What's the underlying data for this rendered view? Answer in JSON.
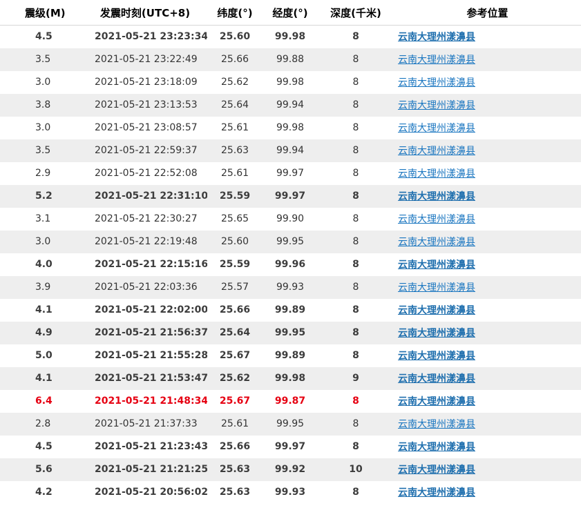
{
  "headers": {
    "magnitude": "震级(M)",
    "time": "发震时刻(UTC+8)",
    "latitude": "纬度(°)",
    "longitude": "经度(°)",
    "depth": "深度(千米)",
    "location": "参考位置"
  },
  "rows": [
    {
      "mag": "4.5",
      "time": "2021-05-21 23:23:34",
      "lat": "25.60",
      "lon": "99.98",
      "depth": "8",
      "loc": "云南大理州漾濞县",
      "style": "bold"
    },
    {
      "mag": "3.5",
      "time": "2021-05-21 23:22:49",
      "lat": "25.66",
      "lon": "99.88",
      "depth": "8",
      "loc": "云南大理州漾濞县",
      "style": "normal"
    },
    {
      "mag": "3.0",
      "time": "2021-05-21 23:18:09",
      "lat": "25.62",
      "lon": "99.98",
      "depth": "8",
      "loc": "云南大理州漾濞县",
      "style": "normal"
    },
    {
      "mag": "3.8",
      "time": "2021-05-21 23:13:53",
      "lat": "25.64",
      "lon": "99.94",
      "depth": "8",
      "loc": "云南大理州漾濞县",
      "style": "normal"
    },
    {
      "mag": "3.0",
      "time": "2021-05-21 23:08:57",
      "lat": "25.61",
      "lon": "99.98",
      "depth": "8",
      "loc": "云南大理州漾濞县",
      "style": "normal"
    },
    {
      "mag": "3.5",
      "time": "2021-05-21 22:59:37",
      "lat": "25.63",
      "lon": "99.94",
      "depth": "8",
      "loc": "云南大理州漾濞县",
      "style": "normal"
    },
    {
      "mag": "2.9",
      "time": "2021-05-21 22:52:08",
      "lat": "25.61",
      "lon": "99.97",
      "depth": "8",
      "loc": "云南大理州漾濞县",
      "style": "normal"
    },
    {
      "mag": "5.2",
      "time": "2021-05-21 22:31:10",
      "lat": "25.59",
      "lon": "99.97",
      "depth": "8",
      "loc": "云南大理州漾濞县",
      "style": "bold"
    },
    {
      "mag": "3.1",
      "time": "2021-05-21 22:30:27",
      "lat": "25.65",
      "lon": "99.90",
      "depth": "8",
      "loc": "云南大理州漾濞县",
      "style": "normal"
    },
    {
      "mag": "3.0",
      "time": "2021-05-21 22:19:48",
      "lat": "25.60",
      "lon": "99.95",
      "depth": "8",
      "loc": "云南大理州漾濞县",
      "style": "normal"
    },
    {
      "mag": "4.0",
      "time": "2021-05-21 22:15:16",
      "lat": "25.59",
      "lon": "99.96",
      "depth": "8",
      "loc": "云南大理州漾濞县",
      "style": "bold"
    },
    {
      "mag": "3.9",
      "time": "2021-05-21 22:03:36",
      "lat": "25.57",
      "lon": "99.93",
      "depth": "8",
      "loc": "云南大理州漾濞县",
      "style": "normal"
    },
    {
      "mag": "4.1",
      "time": "2021-05-21 22:02:00",
      "lat": "25.66",
      "lon": "99.89",
      "depth": "8",
      "loc": "云南大理州漾濞县",
      "style": "bold"
    },
    {
      "mag": "4.9",
      "time": "2021-05-21 21:56:37",
      "lat": "25.64",
      "lon": "99.95",
      "depth": "8",
      "loc": "云南大理州漾濞县",
      "style": "bold"
    },
    {
      "mag": "5.0",
      "time": "2021-05-21 21:55:28",
      "lat": "25.67",
      "lon": "99.89",
      "depth": "8",
      "loc": "云南大理州漾濞县",
      "style": "bold"
    },
    {
      "mag": "4.1",
      "time": "2021-05-21 21:53:47",
      "lat": "25.62",
      "lon": "99.98",
      "depth": "9",
      "loc": "云南大理州漾濞县",
      "style": "bold"
    },
    {
      "mag": "6.4",
      "time": "2021-05-21 21:48:34",
      "lat": "25.67",
      "lon": "99.87",
      "depth": "8",
      "loc": "云南大理州漾濞县",
      "style": "highlight"
    },
    {
      "mag": "2.8",
      "time": "2021-05-21 21:37:33",
      "lat": "25.61",
      "lon": "99.95",
      "depth": "8",
      "loc": "云南大理州漾濞县",
      "style": "normal"
    },
    {
      "mag": "4.5",
      "time": "2021-05-21 21:23:43",
      "lat": "25.66",
      "lon": "99.97",
      "depth": "8",
      "loc": "云南大理州漾濞县",
      "style": "bold"
    },
    {
      "mag": "5.6",
      "time": "2021-05-21 21:21:25",
      "lat": "25.63",
      "lon": "99.92",
      "depth": "10",
      "loc": "云南大理州漾濞县",
      "style": "bold"
    },
    {
      "mag": "4.2",
      "time": "2021-05-21 20:56:02",
      "lat": "25.63",
      "lon": "99.93",
      "depth": "8",
      "loc": "云南大理州漾濞县",
      "style": "bold"
    }
  ],
  "colors": {
    "highlight": "#e60012",
    "link": "#1a76c0",
    "stripe": "#eeeeee"
  }
}
